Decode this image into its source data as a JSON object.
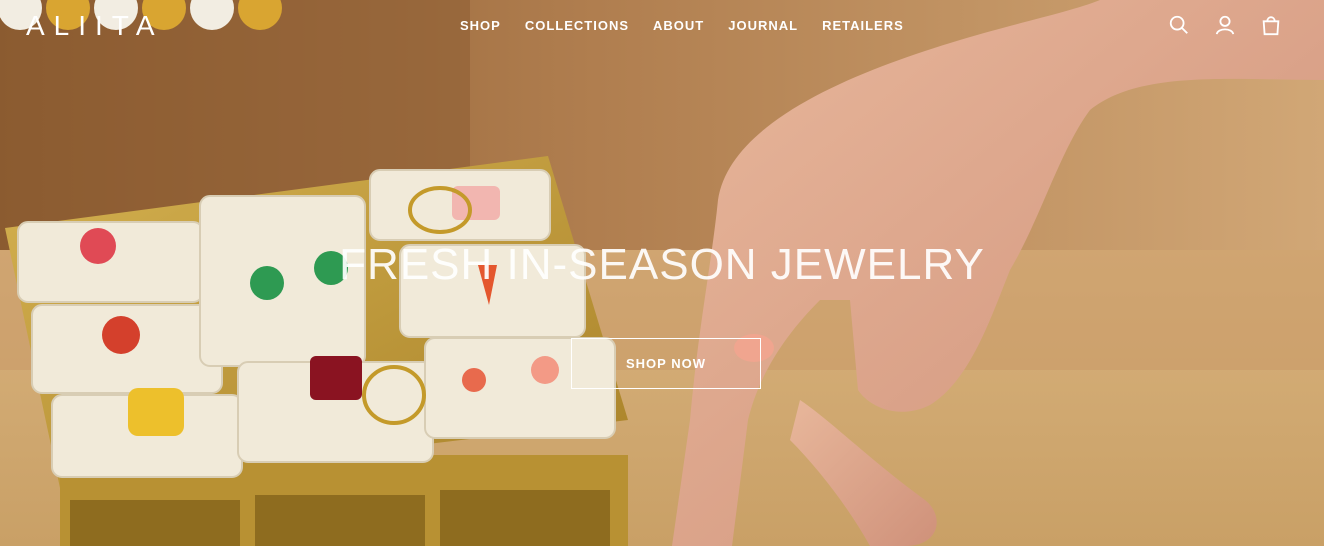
{
  "brand": {
    "logo": "ALIITA"
  },
  "nav": {
    "items": [
      "SHOP",
      "COLLECTIONS",
      "ABOUT",
      "JOURNAL",
      "RETAILERS"
    ]
  },
  "header_icons": [
    "search-icon",
    "account-icon",
    "cart-icon"
  ],
  "hero": {
    "headline": "FRESH IN-SEASON JEWELRY",
    "cta_label": "SHOP NOW"
  },
  "colors": {
    "text": "#ffffff",
    "background": "#c9a273"
  }
}
